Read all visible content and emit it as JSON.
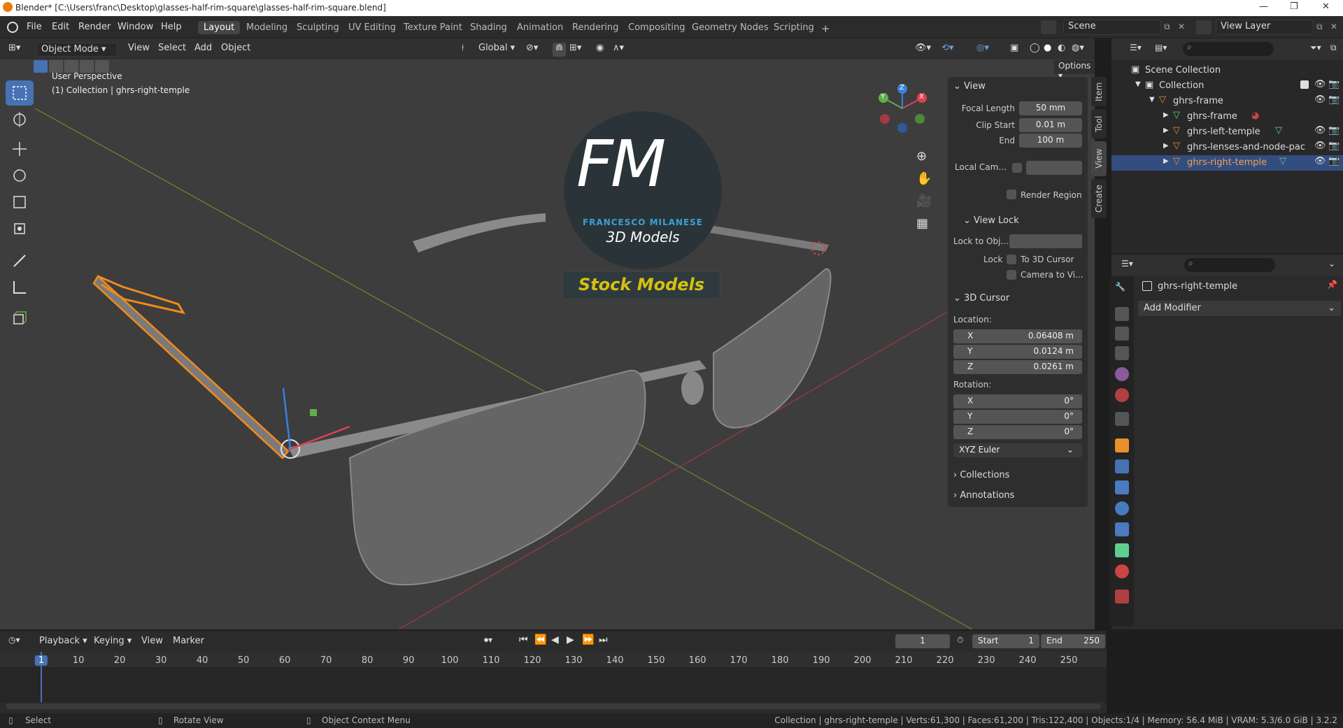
{
  "title_bar": {
    "text": "Blender* [C:\\Users\\franc\\Desktop\\glasses-half-rim-square\\glasses-half-rim-square.blend]"
  },
  "menu": {
    "items": [
      "File",
      "Edit",
      "Render",
      "Window",
      "Help"
    ]
  },
  "workspaces": [
    "Layout",
    "Modeling",
    "Sculpting",
    "UV Editing",
    "Texture Paint",
    "Shading",
    "Animation",
    "Rendering",
    "Compositing",
    "Geometry Nodes",
    "Scripting",
    "+"
  ],
  "top_right": {
    "scene": "Scene",
    "view_layer": "View Layer"
  },
  "viewport_header": {
    "mode": "Object Mode",
    "menus": [
      "View",
      "Select",
      "Add",
      "Object"
    ],
    "orientation": "Global",
    "options": "Options"
  },
  "viewport": {
    "perspective": "User Perspective",
    "collection_info": "(1) Collection | ghrs-right-temple",
    "logo": {
      "letters": "FM",
      "brand": "FRANCESCO MILANESE",
      "tagline": "3D Models",
      "banner": "Stock Models"
    },
    "gizmo": {
      "x": "X",
      "y": "Y",
      "z": "Z"
    }
  },
  "npanel": {
    "view": {
      "header": "View",
      "focal_length_label": "Focal Length",
      "focal_length": "50 mm",
      "clip_start_label": "Clip Start",
      "clip_start": "0.01 m",
      "end_label": "End",
      "end": "100 m",
      "local_cam_label": "Local Cam...",
      "render_region": "Render Region"
    },
    "view_lock": {
      "header": "View Lock",
      "lock_to_obj": "Lock to Obj...",
      "lock_label": "Lock",
      "to_3d_cursor": "To 3D Cursor",
      "camera_to_view": "Camera to Vi..."
    },
    "cursor": {
      "header": "3D Cursor",
      "location_label": "Location:",
      "x_label": "X",
      "x": "0.06408 m",
      "y_label": "Y",
      "y": "0.0124 m",
      "z_label": "Z",
      "z": "0.0261 m",
      "rotation_label": "Rotation:",
      "rx": "0°",
      "ry": "0°",
      "rz": "0°",
      "mode": "XYZ Euler"
    },
    "collections": "Collections",
    "annotations": "Annotations",
    "tabs": [
      "Item",
      "Tool",
      "View",
      "Create"
    ]
  },
  "outliner": {
    "rows": [
      {
        "label": "Scene Collection"
      },
      {
        "label": "Collection"
      },
      {
        "label": "ghrs-frame"
      },
      {
        "label": "ghrs-frame"
      },
      {
        "label": "ghrs-left-temple"
      },
      {
        "label": "ghrs-lenses-and-node-pac"
      },
      {
        "label": "ghrs-right-temple"
      }
    ]
  },
  "properties": {
    "object_name": "ghrs-right-temple",
    "add_modifier": "Add Modifier"
  },
  "timeline": {
    "menus": [
      "Playback",
      "Keying",
      "View",
      "Marker"
    ],
    "current_frame": "1",
    "start_label": "Start",
    "start": "1",
    "end_label": "End",
    "end": "250",
    "ticks": [
      "1",
      "10",
      "20",
      "30",
      "40",
      "50",
      "60",
      "70",
      "80",
      "90",
      "100",
      "110",
      "120",
      "130",
      "140",
      "150",
      "160",
      "170",
      "180",
      "190",
      "200",
      "210",
      "220",
      "230",
      "240",
      "250"
    ]
  },
  "status": {
    "select": "Select",
    "rotate": "Rotate View",
    "context": "Object Context Menu",
    "stats": "Collection | ghrs-right-temple | Verts:61,300 | Faces:61,200 | Tris:122,400 | Objects:1/4 | Memory: 56.4 MiB | VRAM: 5.3/6.0 GiB | 3.2.2"
  }
}
